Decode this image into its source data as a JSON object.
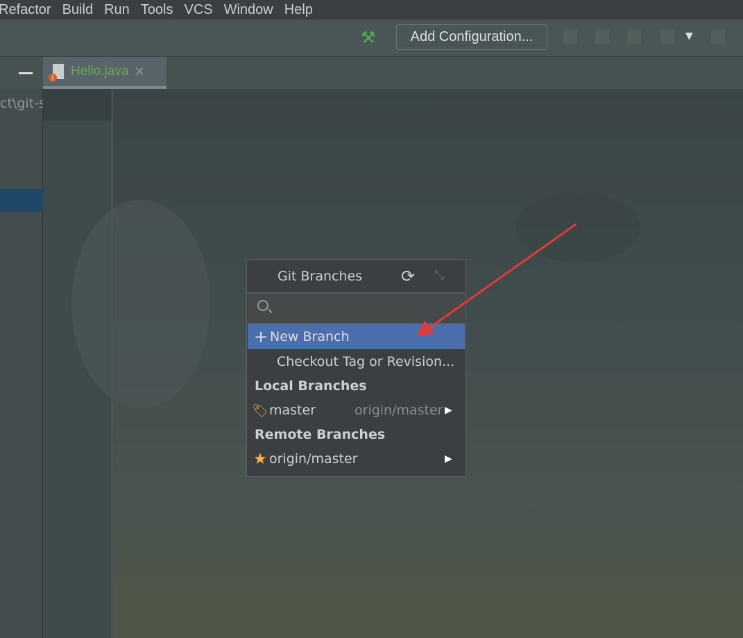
{
  "menu": [
    "Refactor",
    "Build",
    "Run",
    "Tools",
    "VCS",
    "Window",
    "Help"
  ],
  "toolbar": {
    "add_configuration": "Add Configuration..."
  },
  "tab": {
    "file_name": "Hello.java",
    "file_badge": "J"
  },
  "project_panel": {
    "path_fragment": "ct\\git-s"
  },
  "popup": {
    "title": "Git Branches",
    "search_placeholder": "",
    "actions": [
      {
        "label": "New Branch",
        "icon": "plus-icon",
        "highlighted": true
      },
      {
        "label": "Checkout Tag or Revision..."
      }
    ],
    "local_header": "Local Branches",
    "local": [
      {
        "name": "master",
        "tracking": "origin/master",
        "icon": "tag-icon"
      }
    ],
    "remote_header": "Remote Branches",
    "remote": [
      {
        "name": "origin/master",
        "icon": "star-icon"
      }
    ]
  },
  "colors": {
    "highlight": "#4b6eaf",
    "annotation_arrow": "#e53935",
    "tab_text": "#6aa84f"
  }
}
